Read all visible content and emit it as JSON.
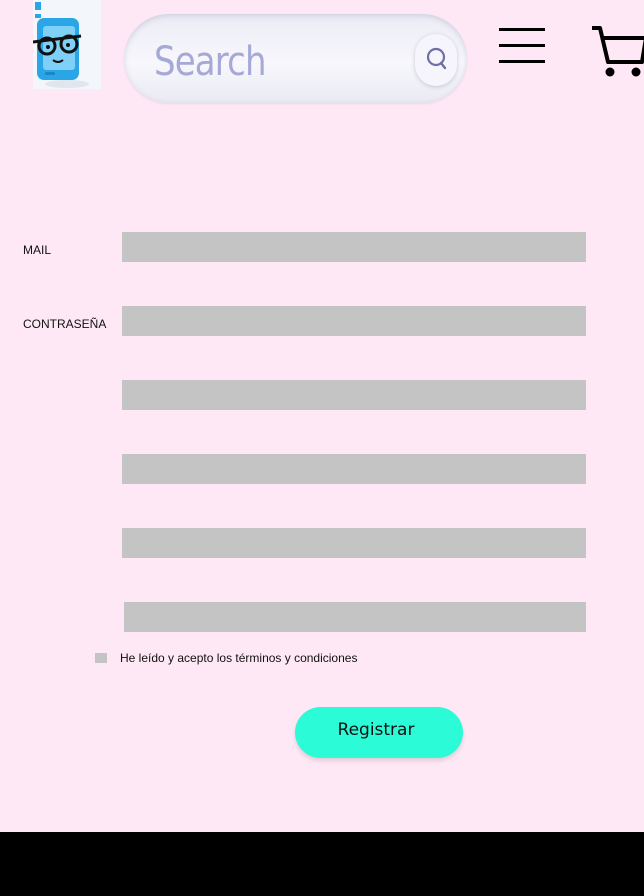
{
  "header": {
    "logo_name": "phone-glasses-mascot-logo",
    "search_placeholder": "Search",
    "search_icon": "search-icon",
    "menu_icon": "hamburger-menu-icon",
    "cart_icon": "shopping-cart-icon"
  },
  "form": {
    "mail_label": "MAIL",
    "password_label": "CONTRASEÑA",
    "terms_label": "He leído y acepto los términos y condiciones",
    "submit_label": "Registrar"
  },
  "colors": {
    "background": "#ffe8f5",
    "field": "#c4c4c4",
    "button": "#2bfbd7",
    "footer": "#000000",
    "search_text": "#a6a9d6",
    "logo_blue": "#2aa5e6"
  }
}
